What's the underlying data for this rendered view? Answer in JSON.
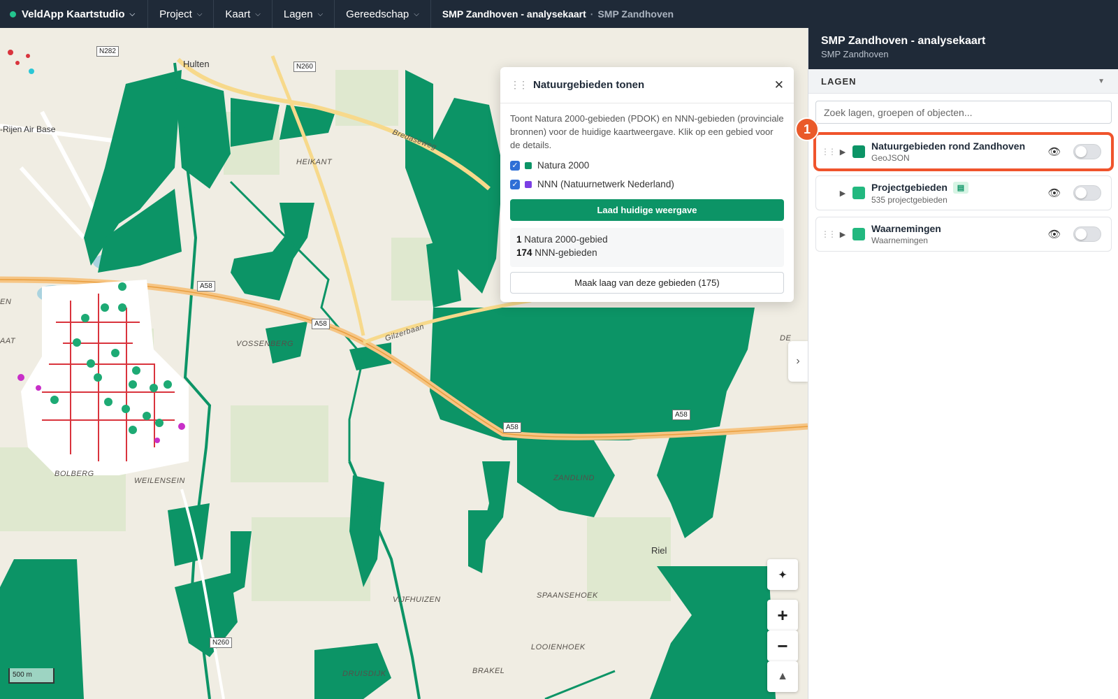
{
  "topbar": {
    "app_name": "VeldApp Kaartstudio",
    "menus": [
      "Project",
      "Kaart",
      "Lagen",
      "Gereedschap"
    ],
    "breadcrumb_title": "SMP Zandhoven - analysekaart",
    "breadcrumb_sub": "SMP Zandhoven"
  },
  "map": {
    "labels": {
      "hulten": "Hulten",
      "rijen": "-Rijen Air Base",
      "heikant": "HEIKANT",
      "vossenberg": "VOSSENBERG",
      "bolberg": "BOLBERG",
      "weilenseind": "WEILENSEIN",
      "zandlind": "ZANDLIND",
      "riel": "Riel",
      "spaansehoek": "SPAANSEHOEK",
      "vijfhuizen": "VIJFHUIZEN",
      "looienhoek": "LOOIENHOEK",
      "druisdijk": "DRUISDIJK",
      "brakel": "BRAKEL",
      "bredaseweg": "Bredaseweg",
      "gilzerbaan": "Gilzerbaan",
      "en": "EN",
      "aat": "AAT",
      "de": "DE"
    },
    "shields": {
      "n282": "N282",
      "n260a": "N260",
      "n260b": "N260",
      "a58a": "A58",
      "a58b": "A58",
      "a58c": "A58",
      "a58d": "A58"
    },
    "scale_label": "500 m",
    "zoom_in": "+",
    "zoom_out": "−",
    "compass": "▲"
  },
  "popup": {
    "title": "Natuurgebieden tonen",
    "close": "✕",
    "description": "Toont Natura 2000-gebieden (PDOK) en NNN-gebieden (provinciale bronnen) voor de huidige kaartweergave. Klik op een gebied voor de details.",
    "options": [
      {
        "label": "Natura 2000",
        "checked": true,
        "color": "#0c9466"
      },
      {
        "label": "NNN (Natuurnetwerk Nederland)",
        "checked": true,
        "color": "#7b3fe4"
      }
    ],
    "load_button": "Laad huidige weergave",
    "count_natura_num": "1",
    "count_natura_text": " Natura 2000-gebied",
    "count_nnn_num": "174",
    "count_nnn_text": " NNN-gebieden",
    "make_layer_button": "Maak laag van deze gebieden (175)"
  },
  "panel": {
    "title": "SMP Zandhoven - analysekaart",
    "subtitle": "SMP Zandhoven",
    "section_label": "LAGEN",
    "search_placeholder": "Zoek lagen, groepen of objecten...",
    "layers": [
      {
        "name": "Natuurgebieden rond Zandhoven",
        "sub": "GeoJSON",
        "color": "#0c9466",
        "visible": false,
        "highlighted": true
      },
      {
        "name": "Projectgebieden",
        "sub": "535 projectgebieden",
        "color": "#22b87f",
        "visible": false,
        "highlighted": false
      },
      {
        "name": "Waarnemingen",
        "sub": "Waarnemingen",
        "color": "#22b87f",
        "visible": false,
        "highlighted": false
      }
    ],
    "callout_number": "1"
  },
  "colors": {
    "nature_green": "#0c9466",
    "topbar_bg": "#1f2a38",
    "highlight": "#f0542c"
  }
}
